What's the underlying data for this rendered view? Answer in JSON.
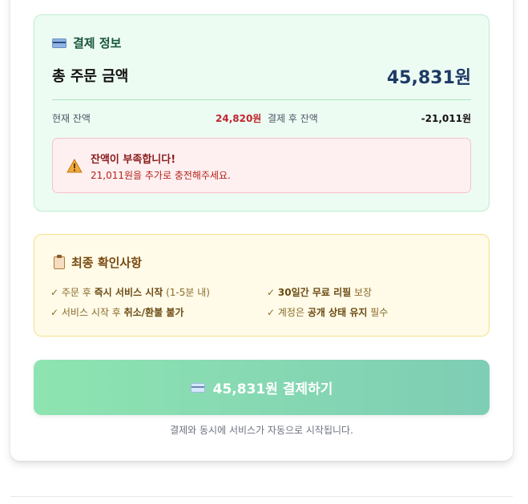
{
  "payment": {
    "title": "결제 정보",
    "total_label": "총 주문 금액",
    "total_amount": "45,831원",
    "current_balance_label": "현재 잔액",
    "current_balance": "24,820원",
    "after_balance_label": "결제 후 잔액",
    "after_balance": "-21,011원",
    "warning_title": "잔액이 부족합니다!",
    "warning_text": "21,011원을 추가로 충전해주세요."
  },
  "confirm": {
    "title": "최종 확인사항",
    "items": [
      {
        "pre": "주문 후 ",
        "bold": "즉시 서비스 시작",
        "post": " (1-5분 내)"
      },
      {
        "pre": "",
        "bold": "30일간 무료 리필",
        "post": " 보장"
      },
      {
        "pre": "서비스 시작 후 ",
        "bold": "취소/환불 불가",
        "post": ""
      },
      {
        "pre": "계정은 ",
        "bold": "공개 상태 유지",
        "post": " 필수"
      }
    ],
    "check_mark": "✓"
  },
  "pay_button": {
    "label": "45,831원 결제하기"
  },
  "notice": "결제와 동시에 서비스가 자동으로 시작됩니다.",
  "colors": {
    "payment_bg": "#edfcf3",
    "warning_bg": "#fef0f1",
    "confirm_bg": "#fffbe8",
    "button_start": "#8ee4b0",
    "button_end": "#7ecdb5",
    "negative": "#c0262d"
  },
  "icons": {
    "payment": "credit-card-icon",
    "warning": "warning-triangle-icon",
    "confirm": "clipboard-icon"
  }
}
